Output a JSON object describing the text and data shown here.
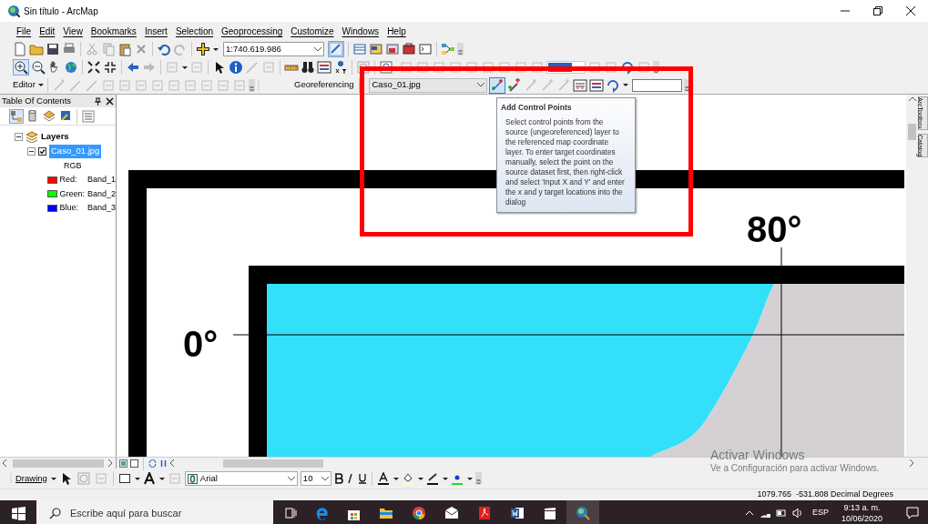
{
  "window": {
    "title": "Sin título - ArcMap"
  },
  "menu": [
    "File",
    "Edit",
    "View",
    "Bookmarks",
    "Insert",
    "Selection",
    "Geoprocessing",
    "Customize",
    "Windows",
    "Help"
  ],
  "standard_toolbar": {
    "scale": "1:740.619.986"
  },
  "editor_toolbar": {
    "editor_menu": "Editor"
  },
  "georeferencing_toolbar": {
    "label": "Georeferencing",
    "layer": "Caso_01.jpg",
    "add_control_points": {
      "selected": true
    }
  },
  "tooltip": {
    "title": "Add Control Points",
    "text": "Select control points from the source (ungeoreferenced) layer to the referenced map coordinate layer. To enter target coordinates manually, select the point on the source dataset first, then right-click and select 'Input X and Y' and enter the x and y target locations into the dialog"
  },
  "toc": {
    "title": "Table Of Contents",
    "root": {
      "label": "Layers",
      "expanded": true,
      "children": [
        {
          "label": "Caso_01.jpg",
          "checked": true,
          "selected": true,
          "expanded": true,
          "legend_title": "RGB",
          "legend": [
            {
              "label": "Red:",
              "band": "Band_1",
              "color": "#ff0000"
            },
            {
              "label": "Green:",
              "band": "Band_2",
              "color": "#00ff00"
            },
            {
              "label": "Blue:",
              "band": "Band_3",
              "color": "#0000ff"
            }
          ]
        }
      ]
    }
  },
  "map": {
    "labels": [
      "80°",
      "0°"
    ]
  },
  "side_tabs": [
    "ArcToolbox",
    "Catalog"
  ],
  "drawing_toolbar": {
    "menu": "Drawing",
    "font": "Arial",
    "size": "10"
  },
  "status_bar": {
    "coordinates": "1079.765  -531.808 Decimal Degrees"
  },
  "activation_notice": {
    "title": "Activar Windows",
    "text": "Ve a Configuración para activar Windows."
  },
  "taskbar": {
    "search_placeholder": "Escribe aquí para buscar",
    "language": "ESP",
    "time": "9:13 a. m.",
    "date": "10/06/2020"
  }
}
